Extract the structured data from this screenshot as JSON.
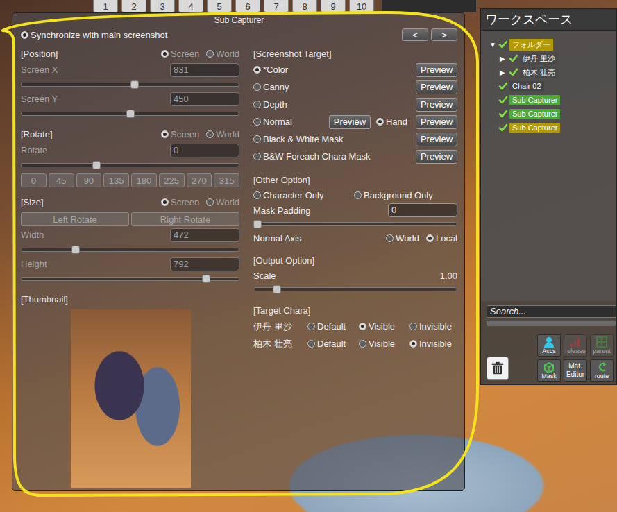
{
  "top_bar": {
    "buttons": [
      "1",
      "2",
      "3",
      "4",
      "5",
      "6",
      "7",
      "8",
      "9",
      "10"
    ]
  },
  "window": {
    "title": "Sub Capturer"
  },
  "sync": {
    "label": "Synchronize with main screenshot",
    "checked": true
  },
  "nav_buttons": [
    "<",
    ">"
  ],
  "left": [
    {
      "kind": "header",
      "label": "[Position]",
      "options": [
        {
          "label": "Screen",
          "selected": true,
          "disabled": true
        },
        {
          "label": "World",
          "selected": false,
          "disabled": true
        }
      ]
    },
    {
      "kind": "field",
      "label": "Screen X",
      "value": "831",
      "disabled": true
    },
    {
      "kind": "slider",
      "level": 0.52,
      "disabled": true
    },
    {
      "kind": "field",
      "label": "Screen Y",
      "value": "450",
      "disabled": true
    },
    {
      "kind": "slider",
      "level": 0.5,
      "disabled": true
    },
    {
      "kind": "header",
      "label": "[Rotate]",
      "options": [
        {
          "label": "Screen",
          "selected": true,
          "disabled": true
        },
        {
          "label": "World",
          "selected": false,
          "disabled": true
        }
      ]
    },
    {
      "kind": "field",
      "label": "Rotate",
      "value": "0",
      "disabled": true
    },
    {
      "kind": "slider",
      "level": 0.34,
      "disabled": true
    },
    {
      "kind": "buttons",
      "labels": [
        "0",
        "45",
        "90",
        "135",
        "180",
        "225",
        "270",
        "315"
      ],
      "disabled": true
    },
    {
      "kind": "header",
      "label": "[Size]",
      "options": [
        {
          "label": "Screen",
          "selected": true,
          "disabled": true
        },
        {
          "label": "World",
          "selected": false,
          "disabled": true
        }
      ]
    },
    {
      "kind": "buttons",
      "labels": [
        "Left Rotate",
        "Right Rotate"
      ],
      "disabled": true
    },
    {
      "kind": "field",
      "label": "Width",
      "value": "472",
      "disabled": true
    },
    {
      "kind": "slider",
      "level": 0.24,
      "disabled": true
    },
    {
      "kind": "field",
      "label": "Height",
      "value": "792",
      "disabled": true
    },
    {
      "kind": "slider",
      "level": 0.86,
      "disabled": true
    },
    {
      "kind": "header",
      "label": "[Thumbnail]",
      "options": []
    },
    {
      "kind": "thumbnail"
    }
  ],
  "right": [
    {
      "kind": "header",
      "label": "[Screenshot Target]"
    },
    {
      "kind": "target",
      "label": "*Color",
      "checked": true,
      "button": "Preview"
    },
    {
      "kind": "target",
      "label": "Canny",
      "checked": false,
      "button": "Preview"
    },
    {
      "kind": "target",
      "label": "Depth",
      "checked": false,
      "button": "Preview"
    },
    {
      "kind": "target",
      "label": "Normal",
      "checked": false,
      "button": "Preview",
      "extra": {
        "label": "Hand",
        "checked": true,
        "button": "Preview"
      }
    },
    {
      "kind": "target",
      "label": "Black & White Mask",
      "checked": false,
      "button": "Preview"
    },
    {
      "kind": "target",
      "label": "B&W Foreach Chara Mask",
      "checked": false,
      "button": "Preview"
    },
    {
      "kind": "header",
      "label": "[Other Option]"
    },
    {
      "kind": "toggles",
      "items": [
        {
          "label": "Character Only",
          "checked": false
        },
        {
          "label": "Background Only",
          "checked": false
        }
      ]
    },
    {
      "kind": "field",
      "label": "Mask Padding",
      "value": "0"
    },
    {
      "kind": "slider",
      "level": 0.0
    },
    {
      "kind": "choice",
      "label": "Normal Axis",
      "items": [
        {
          "label": "World",
          "selected": false
        },
        {
          "label": "Local",
          "selected": true
        }
      ]
    },
    {
      "kind": "header",
      "label": "[Output Option]"
    },
    {
      "kind": "reading",
      "label": "Scale",
      "value": "1.00"
    },
    {
      "kind": "slider",
      "level": 0.1
    },
    {
      "kind": "header",
      "label": "[Target Chara]"
    },
    {
      "kind": "chara",
      "label": "伊丹 里沙",
      "items": [
        {
          "label": "Default",
          "selected": false
        },
        {
          "label": "Visible",
          "selected": true
        },
        {
          "label": "Invisible",
          "selected": false
        }
      ]
    },
    {
      "kind": "chara",
      "label": "柏木 壮亮",
      "items": [
        {
          "label": "Default",
          "selected": false
        },
        {
          "label": "Visible",
          "selected": false
        },
        {
          "label": "Invisible",
          "selected": true
        }
      ]
    }
  ],
  "workspace": {
    "title": "ワークスペース",
    "items": [
      {
        "label": "フォルダー",
        "depth": 0,
        "expander": "▼",
        "checked": true,
        "color": "#b39a00"
      },
      {
        "label": "伊丹 里沙",
        "depth": 1,
        "expander": "▶",
        "checked": true,
        "color": "#4a4a4a"
      },
      {
        "label": "柏木 壮亮",
        "depth": 1,
        "expander": "▶",
        "checked": true,
        "color": "#4a4a4a"
      },
      {
        "label": "Chair 02",
        "depth": 0,
        "checked": true,
        "color": "#454545"
      },
      {
        "label": "Sub Capturer",
        "depth": 0,
        "checked": true,
        "color": "#4fa83c"
      },
      {
        "label": "Sub Capturer",
        "depth": 0,
        "checked": true,
        "color": "#4fa83c"
      },
      {
        "label": "Sub Capturer",
        "depth": 0,
        "checked": true,
        "color": "#b39a00"
      }
    ],
    "search": {
      "placeholder": "Search..."
    },
    "tools": [
      {
        "kind": "accs",
        "label": "Accs",
        "disabled": false
      },
      {
        "kind": "release",
        "label": "release",
        "disabled": true
      },
      {
        "kind": "parent",
        "label": "parent",
        "disabled": true
      },
      {
        "kind": "mask",
        "label": "Mask",
        "disabled": false
      },
      {
        "kind": "text",
        "label": "Mat. Editor",
        "disabled": false
      },
      {
        "kind": "route",
        "label": "route",
        "disabled": false
      }
    ]
  }
}
